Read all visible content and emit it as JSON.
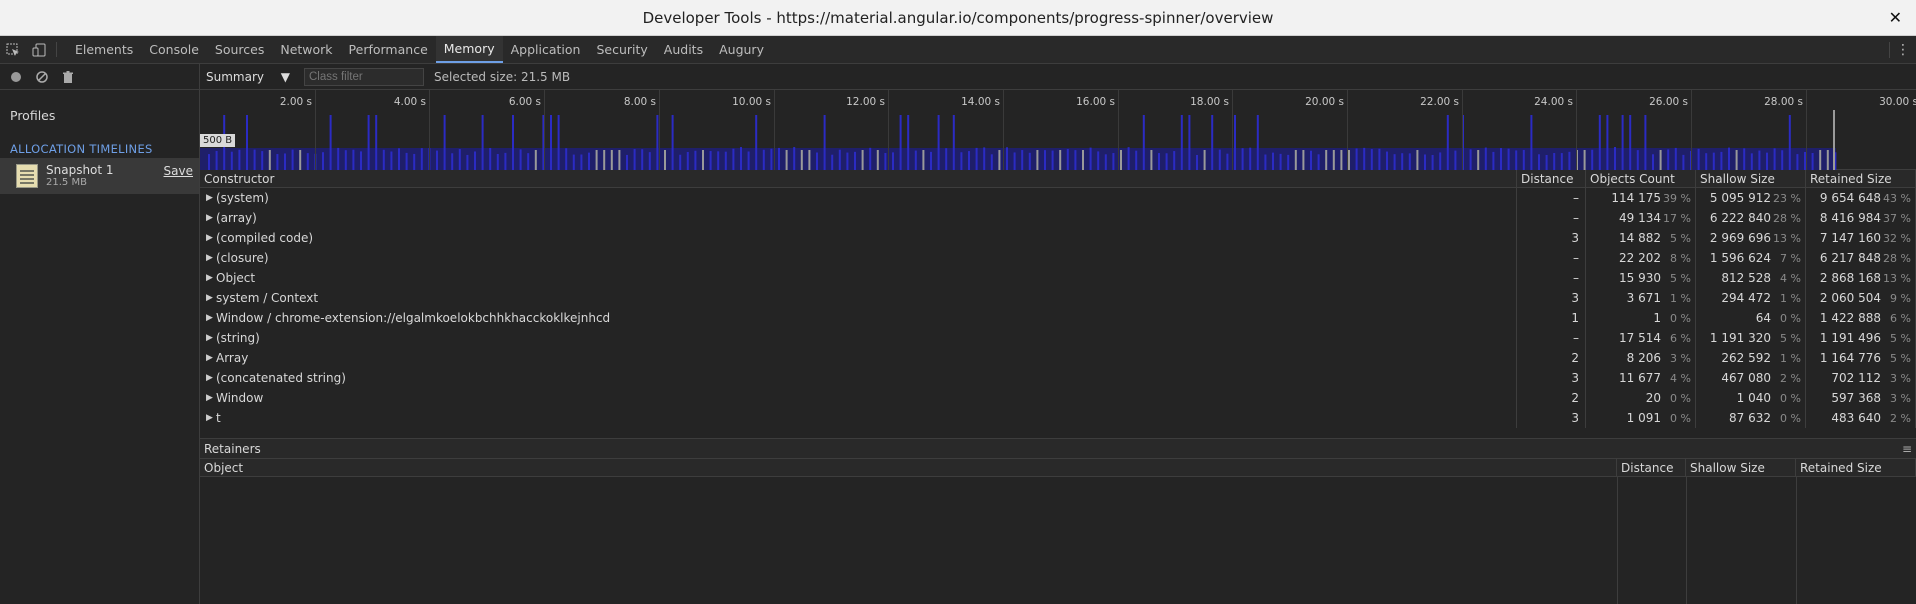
{
  "window": {
    "title": "Developer Tools - https://material.angular.io/components/progress-spinner/overview",
    "close_glyph": "✕"
  },
  "tabs": [
    "Elements",
    "Console",
    "Sources",
    "Network",
    "Performance",
    "Memory",
    "Application",
    "Security",
    "Audits",
    "Augury"
  ],
  "active_tab": "Memory",
  "sidebar": {
    "profiles_heading": "Profiles",
    "section_heading": "ALLOCATION TIMELINES",
    "snapshot": {
      "name": "Snapshot 1",
      "size": "21.5 MB",
      "save_label": "Save"
    }
  },
  "toolbar": {
    "view_select": "Summary",
    "class_filter_placeholder": "Class filter",
    "selected_size": "Selected size: 21.5 MB"
  },
  "timeline": {
    "ticks": [
      "2.00 s",
      "4.00 s",
      "6.00 s",
      "8.00 s",
      "10.00 s",
      "12.00 s",
      "14.00 s",
      "16.00 s",
      "18.00 s",
      "20.00 s",
      "22.00 s",
      "24.00 s",
      "26.00 s",
      "28.00 s",
      "30.00 s"
    ],
    "scale_label": "500 B"
  },
  "table": {
    "headers": {
      "constructor": "Constructor",
      "distance": "Distance",
      "objects": "Objects Count",
      "shallow": "Shallow Size",
      "retained": "Retained Size"
    },
    "rows": [
      {
        "name": "(system)",
        "distance": "–",
        "objects": "114 175",
        "objects_pct": "39 %",
        "shallow": "5 095 912",
        "shallow_pct": "23 %",
        "retained": "9 654 648",
        "retained_pct": "43 %"
      },
      {
        "name": "(array)",
        "distance": "–",
        "objects": "49 134",
        "objects_pct": "17 %",
        "shallow": "6 222 840",
        "shallow_pct": "28 %",
        "retained": "8 416 984",
        "retained_pct": "37 %"
      },
      {
        "name": "(compiled code)",
        "distance": "3",
        "objects": "14 882",
        "objects_pct": "5 %",
        "shallow": "2 969 696",
        "shallow_pct": "13 %",
        "retained": "7 147 160",
        "retained_pct": "32 %"
      },
      {
        "name": "(closure)",
        "distance": "–",
        "objects": "22 202",
        "objects_pct": "8 %",
        "shallow": "1 596 624",
        "shallow_pct": "7 %",
        "retained": "6 217 848",
        "retained_pct": "28 %"
      },
      {
        "name": "Object",
        "distance": "–",
        "objects": "15 930",
        "objects_pct": "5 %",
        "shallow": "812 528",
        "shallow_pct": "4 %",
        "retained": "2 868 168",
        "retained_pct": "13 %"
      },
      {
        "name": "system / Context",
        "distance": "3",
        "objects": "3 671",
        "objects_pct": "1 %",
        "shallow": "294 472",
        "shallow_pct": "1 %",
        "retained": "2 060 504",
        "retained_pct": "9 %"
      },
      {
        "name": "Window / chrome-extension://elgalmkoelokbchhkhacckoklkejnhcd",
        "distance": "1",
        "objects": "1",
        "objects_pct": "0 %",
        "shallow": "64",
        "shallow_pct": "0 %",
        "retained": "1 422 888",
        "retained_pct": "6 %"
      },
      {
        "name": "(string)",
        "distance": "–",
        "objects": "17 514",
        "objects_pct": "6 %",
        "shallow": "1 191 320",
        "shallow_pct": "5 %",
        "retained": "1 191 496",
        "retained_pct": "5 %"
      },
      {
        "name": "Array",
        "distance": "2",
        "objects": "8 206",
        "objects_pct": "3 %",
        "shallow": "262 592",
        "shallow_pct": "1 %",
        "retained": "1 164 776",
        "retained_pct": "5 %"
      },
      {
        "name": "(concatenated string)",
        "distance": "3",
        "objects": "11 677",
        "objects_pct": "4 %",
        "shallow": "467 080",
        "shallow_pct": "2 %",
        "retained": "702 112",
        "retained_pct": "3 %"
      },
      {
        "name": "Window",
        "distance": "2",
        "objects": "20",
        "objects_pct": "0 %",
        "shallow": "1 040",
        "shallow_pct": "0 %",
        "retained": "597 368",
        "retained_pct": "3 %"
      },
      {
        "name": "t",
        "distance": "3",
        "objects": "1 091",
        "objects_pct": "0 %",
        "shallow": "87 632",
        "shallow_pct": "0 %",
        "retained": "483 640",
        "retained_pct": "2 %"
      }
    ]
  },
  "retainers": {
    "title": "Retainers",
    "headers": {
      "object": "Object",
      "distance": "Distance",
      "shallow": "Shallow Size",
      "retained": "Retained Size"
    }
  },
  "colors": {
    "accent": "#6e9fe6",
    "bar_blue": "#2b2bc4",
    "bar_gray": "#9a9a9a"
  }
}
